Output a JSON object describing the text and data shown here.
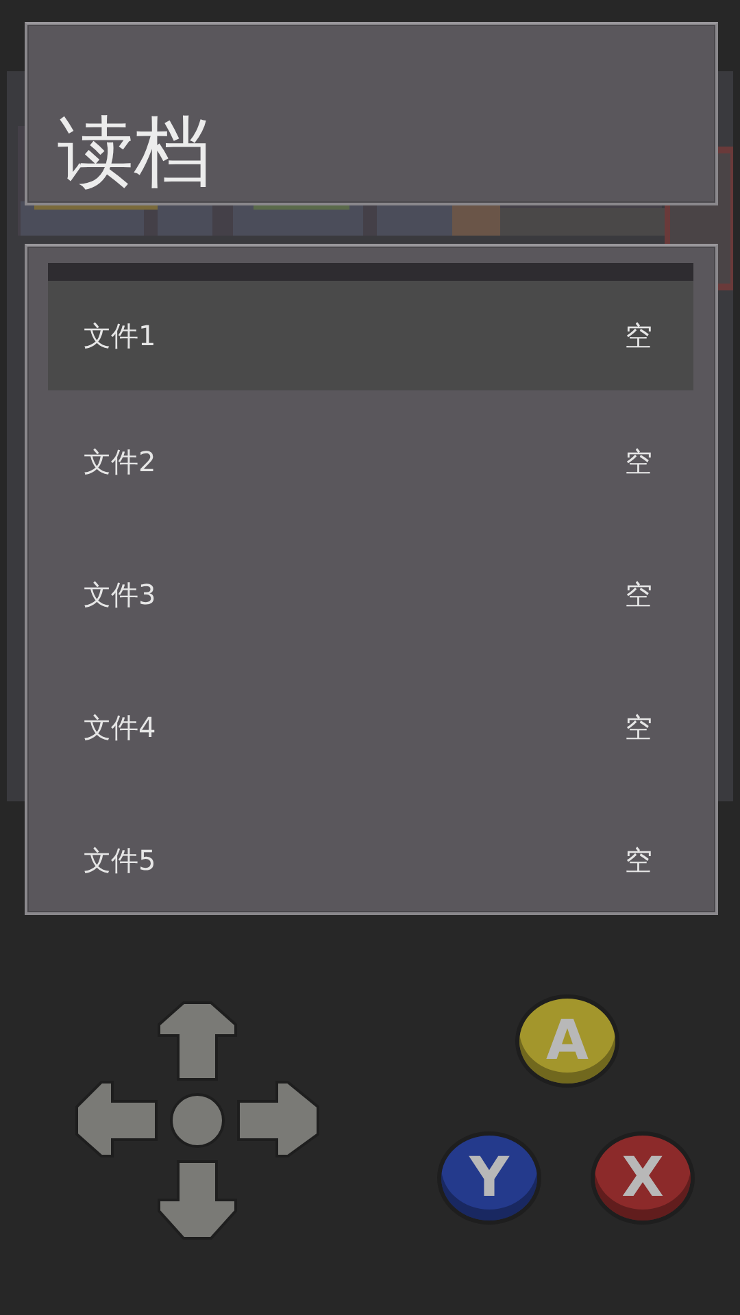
{
  "title": "读档",
  "files": [
    {
      "name": "文件1",
      "status": "空",
      "selected": true
    },
    {
      "name": "文件2",
      "status": "空",
      "selected": false
    },
    {
      "name": "文件3",
      "status": "空",
      "selected": false
    },
    {
      "name": "文件4",
      "status": "空",
      "selected": false
    },
    {
      "name": "文件5",
      "status": "空",
      "selected": false
    }
  ],
  "buttons": [
    {
      "label": "A",
      "color": "#a3962c"
    },
    {
      "label": "Y",
      "color": "#243a8c"
    },
    {
      "label": "X",
      "color": "#8c2a2a"
    }
  ]
}
